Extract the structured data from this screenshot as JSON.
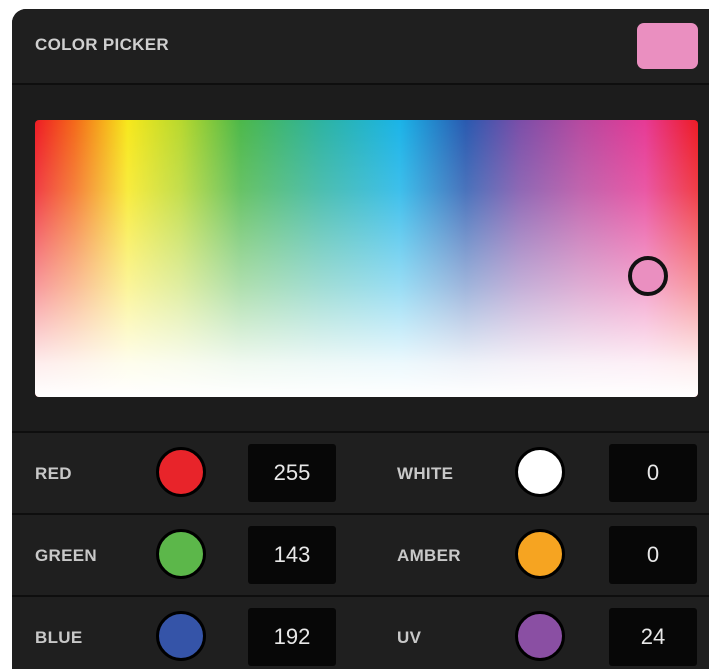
{
  "header": {
    "title": "COLOR PICKER",
    "preview_color": "#ea8fc0"
  },
  "spectrum": {
    "selected_color": "#ea8fc0"
  },
  "channels": [
    {
      "label": "RED",
      "value": "255",
      "color": "#e8242a"
    },
    {
      "label": "WHITE",
      "value": "0",
      "color": "#ffffff"
    },
    {
      "label": "GREEN",
      "value": "143",
      "color": "#5cb74a"
    },
    {
      "label": "AMBER",
      "value": "0",
      "color": "#f6a421"
    },
    {
      "label": "BLUE",
      "value": "192",
      "color": "#3554a8"
    },
    {
      "label": "UV",
      "value": "24",
      "color": "#8a4fa3"
    }
  ]
}
